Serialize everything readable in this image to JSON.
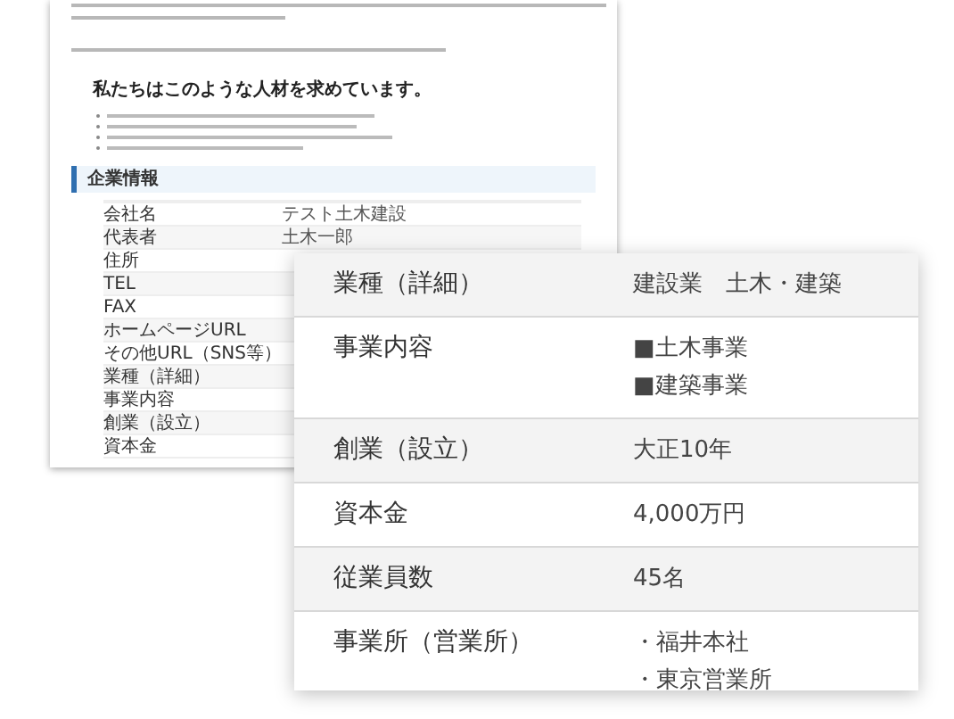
{
  "background_page": {
    "heading": "私たちはこのような人材を求めています。",
    "section_title": "企業情報",
    "table": [
      {
        "label": "会社名",
        "value": "テスト土木建設"
      },
      {
        "label": "代表者",
        "value": "土木一郎"
      },
      {
        "label": "住所"
      },
      {
        "label": "TEL"
      },
      {
        "label": "FAX"
      },
      {
        "label": "ホームページURL"
      },
      {
        "label": "その他URL（SNS等）"
      },
      {
        "label": "業種（詳細）"
      },
      {
        "label": "事業内容"
      },
      {
        "label": "創業（設立）"
      },
      {
        "label": "資本金"
      }
    ]
  },
  "detail_card": {
    "rows": [
      {
        "label": "業種（詳細）",
        "values": [
          "建設業　土木・建築"
        ]
      },
      {
        "label": "事業内容",
        "values": [
          "■土木事業",
          "■建築事業"
        ]
      },
      {
        "label": "創業（設立）",
        "values": [
          "大正10年"
        ]
      },
      {
        "label": "資本金",
        "values": [
          "4,000万円"
        ]
      },
      {
        "label": "従業員数",
        "values": [
          "45名"
        ]
      },
      {
        "label": "事業所（営業所）",
        "values": [
          "・福井本社",
          "・東京営業所"
        ]
      }
    ]
  }
}
